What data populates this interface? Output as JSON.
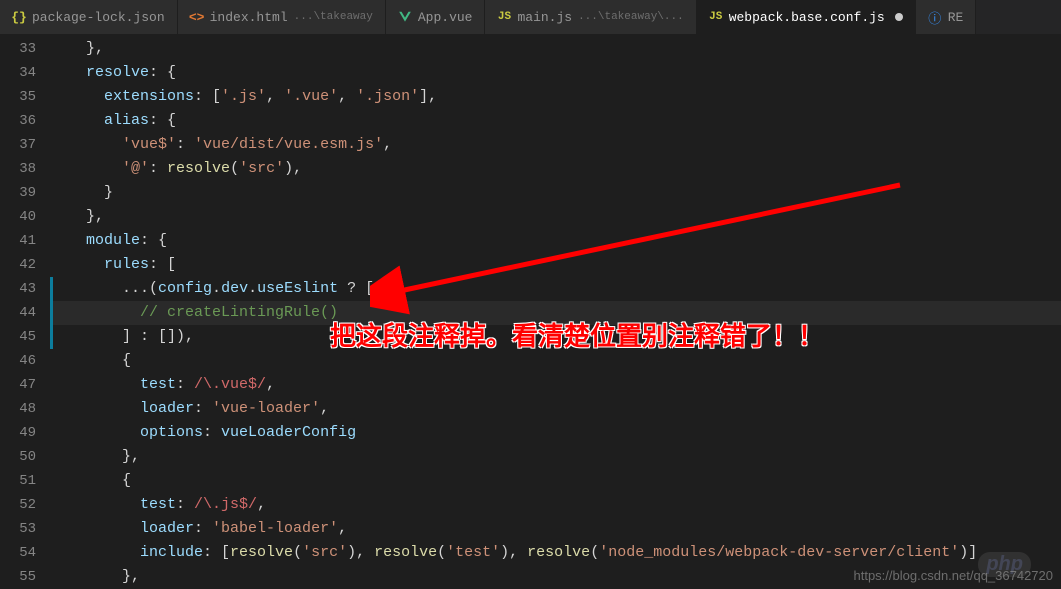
{
  "tabs": [
    {
      "icon": "braces-icon",
      "iconColor": "#cbcb41",
      "label": "package-lock.json",
      "sub": "",
      "active": false
    },
    {
      "icon": "code-icon",
      "iconColor": "#e37933",
      "label": "index.html",
      "sub": "...\\takeaway",
      "active": false
    },
    {
      "icon": "vue-icon",
      "iconColor": "#41b883",
      "label": "App.vue",
      "sub": "",
      "active": false
    },
    {
      "icon": "js-icon",
      "iconColor": "#cbcb41",
      "label": "main.js",
      "sub": "...\\takeaway\\...",
      "active": false
    },
    {
      "icon": "js-icon",
      "iconColor": "#cbcb41",
      "label": "webpack.base.conf.js",
      "sub": "",
      "active": true,
      "dirty": true
    },
    {
      "icon": "info-icon",
      "iconColor": "#3794ff",
      "label": "RE",
      "sub": "",
      "active": false
    }
  ],
  "lineStart": 33,
  "lines": [
    {
      "n": 33,
      "html": "    <span class='p'>},</span>"
    },
    {
      "n": 34,
      "html": "    <span class='n'>resolve</span><span class='p'>: {</span>"
    },
    {
      "n": 35,
      "html": "      <span class='n'>extensions</span><span class='p'>: [</span><span class='s'>'.js'</span><span class='p'>, </span><span class='s'>'.vue'</span><span class='p'>, </span><span class='s'>'.json'</span><span class='p'>],</span>"
    },
    {
      "n": 36,
      "html": "      <span class='n'>alias</span><span class='p'>: {</span>"
    },
    {
      "n": 37,
      "html": "        <span class='s'>'vue$'</span><span class='p'>: </span><span class='s'>'vue/dist/vue.esm.js'</span><span class='p'>,</span>"
    },
    {
      "n": 38,
      "html": "        <span class='s'>'@'</span><span class='p'>: </span><span class='f'>resolve</span><span class='p'>(</span><span class='s'>'src'</span><span class='p'>),</span>"
    },
    {
      "n": 39,
      "html": "      <span class='p'>}</span>"
    },
    {
      "n": 40,
      "html": "    <span class='p'>},</span>"
    },
    {
      "n": 41,
      "html": "    <span class='n'>module</span><span class='p'>: {</span>"
    },
    {
      "n": 42,
      "html": "      <span class='n'>rules</span><span class='p'>: [</span>"
    },
    {
      "n": 43,
      "html": "        <span class='p'>...(</span><span class='n'>config</span><span class='p'>.</span><span class='n'>dev</span><span class='p'>.</span><span class='n'>useEslint</span> <span class='p'>? [</span>",
      "mod": true
    },
    {
      "n": 44,
      "html": "          <span class='c'>// createLintingRule()</span>",
      "mod": true,
      "cursor": true
    },
    {
      "n": 45,
      "html": "        <span class='p'>] : []),</span>",
      "mod": true
    },
    {
      "n": 46,
      "html": "        <span class='p'>{</span>"
    },
    {
      "n": 47,
      "html": "          <span class='n'>test</span><span class='p'>: </span><span class='r'>/\\.vue$/</span><span class='p'>,</span>"
    },
    {
      "n": 48,
      "html": "          <span class='n'>loader</span><span class='p'>: </span><span class='s'>'vue-loader'</span><span class='p'>,</span>"
    },
    {
      "n": 49,
      "html": "          <span class='n'>options</span><span class='p'>: </span><span class='n'>vueLoaderConfig</span>"
    },
    {
      "n": 50,
      "html": "        <span class='p'>},</span>"
    },
    {
      "n": 51,
      "html": "        <span class='p'>{</span>"
    },
    {
      "n": 52,
      "html": "          <span class='n'>test</span><span class='p'>: </span><span class='r'>/\\.js$/</span><span class='p'>,</span>"
    },
    {
      "n": 53,
      "html": "          <span class='n'>loader</span><span class='p'>: </span><span class='s'>'babel-loader'</span><span class='p'>,</span>"
    },
    {
      "n": 54,
      "html": "          <span class='n'>include</span><span class='p'>: [</span><span class='f'>resolve</span><span class='p'>(</span><span class='s'>'src'</span><span class='p'>), </span><span class='f'>resolve</span><span class='p'>(</span><span class='s'>'test'</span><span class='p'>), </span><span class='f'>resolve</span><span class='p'>(</span><span class='s'>'node_modules/webpack-dev-server/client'</span><span class='p'>)]</span>"
    },
    {
      "n": 55,
      "html": "        <span class='p'>},</span>"
    }
  ],
  "annotation": {
    "text": "把这段注释掉。看清楚位置别注释错了！！"
  },
  "watermark": "https://blog.csdn.net/qq_36742720",
  "phpwm": "php"
}
